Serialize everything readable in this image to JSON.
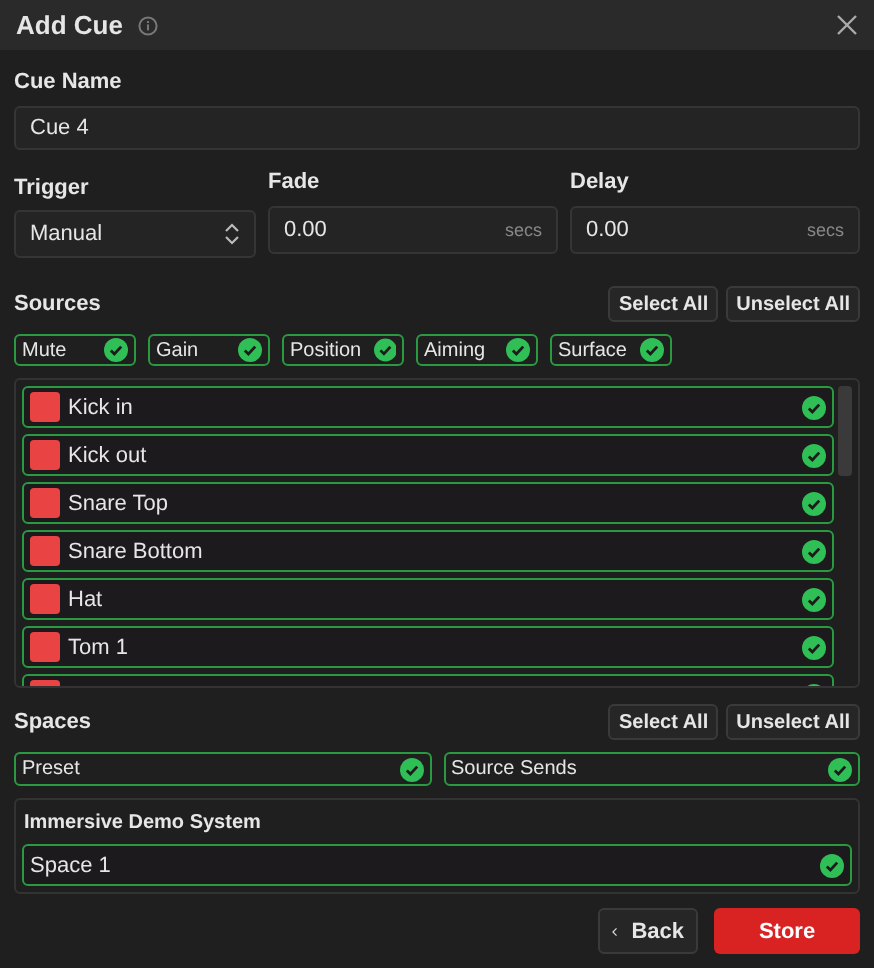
{
  "window": {
    "title": "Add Cue"
  },
  "cue_name": {
    "label": "Cue Name",
    "value": "Cue 4"
  },
  "trigger": {
    "label": "Trigger",
    "value": "Manual"
  },
  "fade": {
    "label": "Fade",
    "value": "0.00",
    "unit": "secs"
  },
  "delay": {
    "label": "Delay",
    "value": "0.00",
    "unit": "secs"
  },
  "sources": {
    "title": "Sources",
    "buttons": [
      "Select All",
      "Unselect All"
    ],
    "filters": [
      {
        "label": "Mute",
        "checked": true
      },
      {
        "label": "Gain",
        "checked": true
      },
      {
        "label": "Position",
        "checked": true
      },
      {
        "label": "Aiming",
        "checked": true
      },
      {
        "label": "Surface",
        "checked": true
      }
    ],
    "items": [
      {
        "label": "Kick in",
        "color": "#e94343",
        "checked": true
      },
      {
        "label": "Kick out",
        "color": "#e94343",
        "checked": true
      },
      {
        "label": "Snare Top",
        "color": "#e94343",
        "checked": true
      },
      {
        "label": "Snare Bottom",
        "color": "#e94343",
        "checked": true
      },
      {
        "label": "Hat",
        "color": "#e94343",
        "checked": true
      },
      {
        "label": "Tom 1",
        "color": "#e94343",
        "checked": true
      },
      {
        "color": "#e94343",
        "checked": true
      }
    ]
  },
  "spaces": {
    "title": "Spaces",
    "buttons": [
      "Select All",
      "Unselect All"
    ],
    "filters": [
      {
        "label": "Preset",
        "checked": true
      },
      {
        "label": "Source Sends",
        "checked": true
      }
    ],
    "group": {
      "title": "Immersive Demo System",
      "items": [
        {
          "label": "Space 1",
          "checked": true
        }
      ]
    }
  },
  "footer": {
    "back": "Back",
    "store": "Store"
  }
}
